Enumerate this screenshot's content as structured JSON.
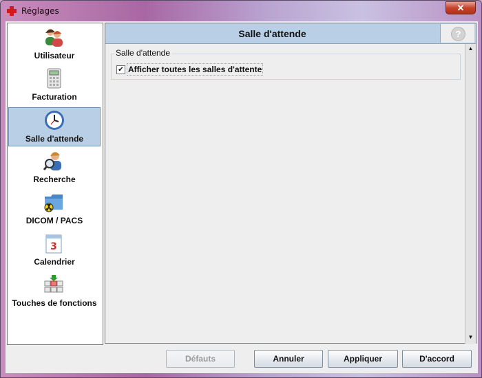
{
  "window": {
    "title": "Réglages",
    "close_label": "✕"
  },
  "sidebar": {
    "items": [
      {
        "label": "Utilisateur",
        "icon": "users-icon"
      },
      {
        "label": "Facturation",
        "icon": "calculator-icon"
      },
      {
        "label": "Salle d'attende",
        "icon": "clock-icon",
        "selected": true
      },
      {
        "label": "Recherche",
        "icon": "user-search-icon"
      },
      {
        "label": "DICOM / PACS",
        "icon": "radiation-folder-icon"
      },
      {
        "label": "Calendrier",
        "icon": "calendar-icon"
      },
      {
        "label": "Touches de fonctions",
        "icon": "function-keys-icon"
      }
    ]
  },
  "main": {
    "title": "Salle d'attende",
    "help_label": "?",
    "group": {
      "title": "Salle d'attende",
      "checkbox_label": "Afficher toutes les salles d'attente",
      "checked": true
    }
  },
  "buttons": {
    "defaults": "Défauts",
    "cancel": "Annuler",
    "apply": "Appliquer",
    "ok": "D'accord"
  },
  "colors": {
    "selection": "#b8cfe5",
    "header": "#b8cfe5",
    "close": "#c7432b"
  }
}
